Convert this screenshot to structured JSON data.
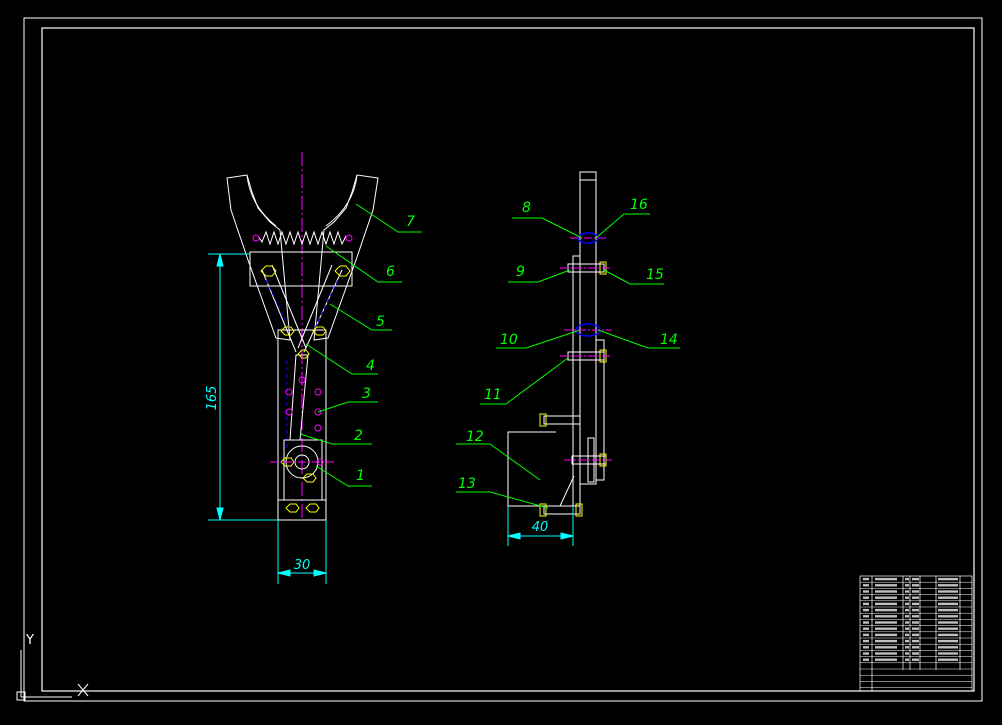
{
  "canvas": {
    "background": "#000000",
    "colors": {
      "frame": "#ffffff",
      "part": "#ffffff",
      "centerline": "#ff00ff",
      "dimension": "#00ffff",
      "leader": "#00ff00",
      "hidden": "#0000ff",
      "fastener": "#ffff00",
      "pin": "#ff00ff"
    }
  },
  "ucs_icon": {
    "y_label": "Y",
    "x_label": "X"
  },
  "dimensions": {
    "height": "165",
    "width": "30",
    "side_width": "40"
  },
  "callouts_front": [
    "1",
    "2",
    "3",
    "4",
    "5",
    "6",
    "7"
  ],
  "callouts_side": [
    "8",
    "9",
    "10",
    "11",
    "12",
    "13",
    "14",
    "15",
    "16"
  ]
}
